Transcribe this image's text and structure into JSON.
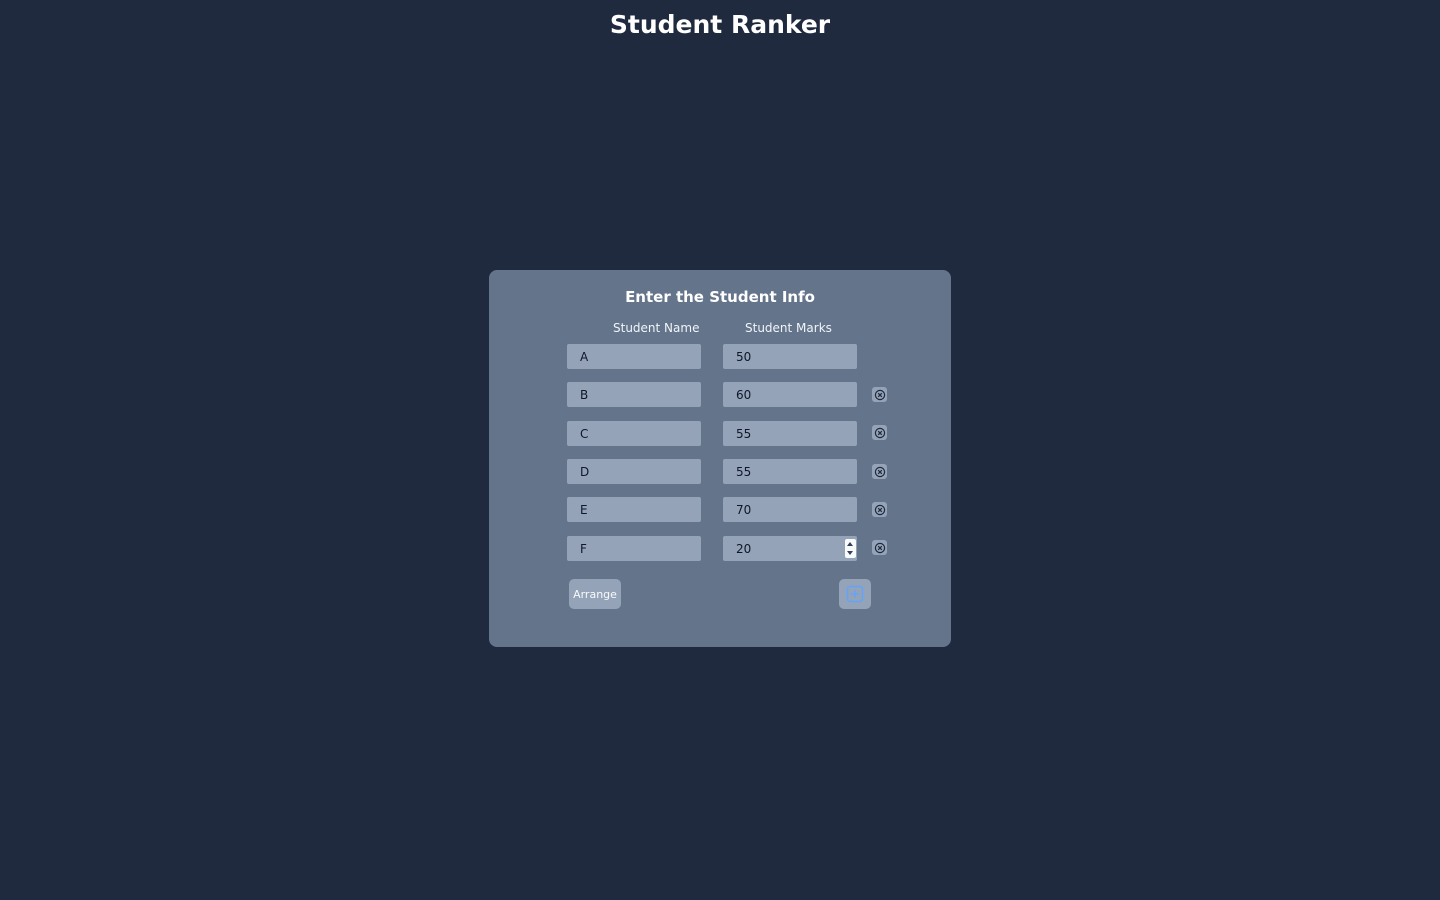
{
  "app": {
    "title": "Student Ranker"
  },
  "form": {
    "title": "Enter the Student Info",
    "headers": {
      "name": "Student Name",
      "marks": "Student Marks"
    },
    "rows": [
      {
        "name": "A",
        "marks": "50",
        "removable": false
      },
      {
        "name": "B",
        "marks": "60",
        "removable": true
      },
      {
        "name": "C",
        "marks": "55",
        "removable": true
      },
      {
        "name": "D",
        "marks": "55",
        "removable": true
      },
      {
        "name": "E",
        "marks": "70",
        "removable": true
      },
      {
        "name": "F",
        "marks": "20",
        "removable": true,
        "focused_spinner": true
      }
    ],
    "arrange_label": "Arrange",
    "add_icon": "plus-square-icon",
    "remove_icon": "x-circle-icon"
  },
  "colors": {
    "background": "#1f2a3f",
    "card": "#64748b",
    "field": "#94a3b8",
    "accent": "#60a5fa"
  }
}
